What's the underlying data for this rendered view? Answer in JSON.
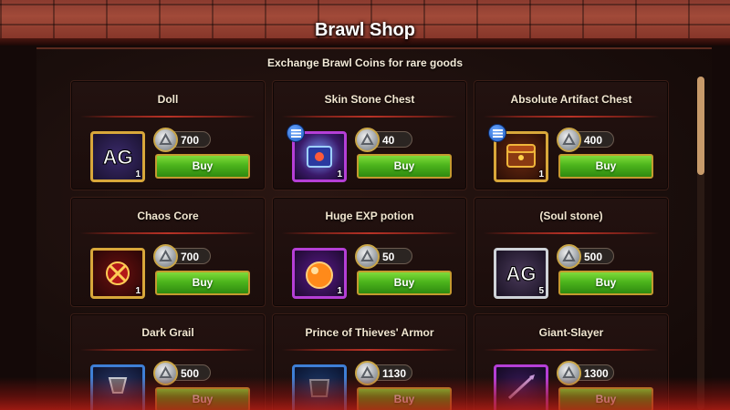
{
  "header": {
    "title": "Brawl Shop"
  },
  "subtitle": "Exchange Brawl Coins for rare goods",
  "items": [
    {
      "name": "Doll",
      "price": "700",
      "buy_label": "Buy",
      "qty": "1",
      "frame": "gold",
      "icon": "ag-logo-icon",
      "list_badge": false
    },
    {
      "name": "Skin Stone Chest",
      "price": "40",
      "buy_label": "Buy",
      "qty": "1",
      "frame": "purple",
      "icon": "chest-icon",
      "list_badge": true
    },
    {
      "name": "Absolute Artifact Chest",
      "price": "400",
      "buy_label": "Buy",
      "qty": "1",
      "frame": "gold",
      "icon": "treasure-chest-icon",
      "list_badge": true
    },
    {
      "name": "Chaos Core",
      "price": "700",
      "buy_label": "Buy",
      "qty": "1",
      "frame": "gold",
      "icon": "chaos-core-icon",
      "list_badge": false
    },
    {
      "name": "Huge EXP potion",
      "price": "50",
      "buy_label": "Buy",
      "qty": "1",
      "frame": "purple",
      "icon": "potion-icon",
      "list_badge": false
    },
    {
      "name": "(Soul stone)",
      "price": "500",
      "buy_label": "Buy",
      "qty": "5",
      "frame": "silver",
      "icon": "ag-logo-icon",
      "list_badge": false
    },
    {
      "name": "Dark Grail",
      "price": "500",
      "buy_label": "Buy",
      "qty": "",
      "frame": "blue",
      "icon": "grail-icon",
      "list_badge": false
    },
    {
      "name": "Prince of Thieves' Armor",
      "price": "1130",
      "buy_label": "Buy",
      "qty": "",
      "frame": "blue",
      "icon": "armor-icon",
      "list_badge": false
    },
    {
      "name": "Giant-Slayer",
      "price": "1300",
      "buy_label": "Buy",
      "qty": "",
      "frame": "purple",
      "icon": "weapon-icon",
      "list_badge": false
    }
  ],
  "scroll": {
    "position": 0
  },
  "colors": {
    "buy_green": "#4cb41c",
    "frame_gold": "#d8a73a",
    "frame_purple": "#b53fd6",
    "frame_blue": "#3e7fd6",
    "header_red": "#a14a39"
  }
}
